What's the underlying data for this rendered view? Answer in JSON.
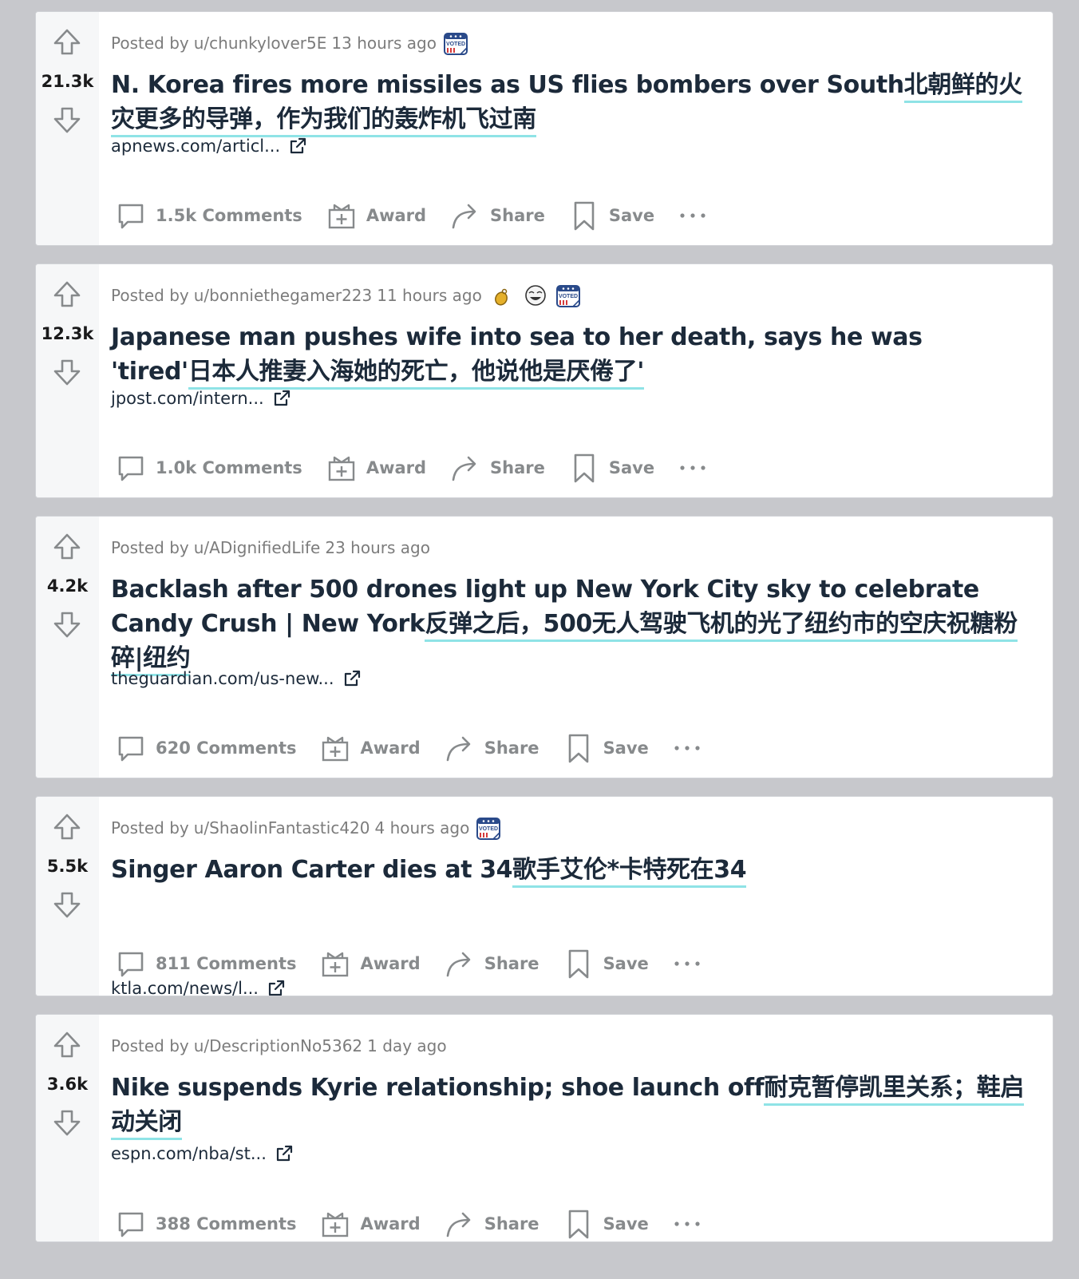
{
  "colors": {
    "page_bg": "#c7c8cc",
    "card_bg": "#ffffff",
    "vote_col_bg": "#f6f7f8",
    "title_text": "#1c2a3a",
    "meta_text": "#7c7c7c",
    "action_text": "#878a8c",
    "translation_underline": "#8fe3e6"
  },
  "labels": {
    "posted_by": "Posted by",
    "award": "Award",
    "share": "Share",
    "save": "Save"
  },
  "posts": [
    {
      "score": "21.3k",
      "author": "u/chunkylover5E",
      "time": "13 hours ago",
      "awards": [
        "voted-sticker-icon"
      ],
      "title": "N. Korea fires more missiles as US flies bombers over South",
      "translation": "北朝鲜的火灾更多的导弹，作为我们的轰炸机飞过南",
      "link": "apnews.com/articl...",
      "comments": "1.5k Comments"
    },
    {
      "score": "12.3k",
      "author": "u/bonniethegamer223",
      "time": "11 hours ago",
      "awards": [
        "gold-bell-award-icon",
        "laughing-face-award-icon",
        "voted-sticker-icon"
      ],
      "title": "Japanese man pushes wife into sea to her death, says he was 'tired'",
      "translation": "日本人推妻入海她的死亡，他说他是厌倦了'",
      "link": "jpost.com/intern...",
      "comments": "1.0k Comments"
    },
    {
      "score": "4.2k",
      "author": "u/ADignifiedLife",
      "time": "23 hours ago",
      "awards": [],
      "title": "Backlash after 500 drones light up New York City sky to celebrate Candy Crush | New York",
      "translation": "反弹之后，500无人驾驶飞机的光了纽约市的空庆祝糖粉碎|纽约",
      "link": "theguardian.com/us-new...",
      "comments": "620 Comments"
    },
    {
      "score": "5.5k",
      "author": "u/ShaolinFantastic420",
      "time": "4 hours ago",
      "awards": [
        "voted-sticker-icon"
      ],
      "title": "Singer Aaron Carter dies at 34",
      "translation": "歌手艾伦*卡特死在34",
      "link": "ktla.com/news/l...",
      "comments": "811 Comments"
    },
    {
      "score": "3.6k",
      "author": "u/DescriptionNo5362",
      "time": "1 day ago",
      "awards": [],
      "title": "Nike suspends Kyrie relationship; shoe launch off",
      "translation": "耐克暂停凯里关系；鞋启动关闭",
      "link": "espn.com/nba/st...",
      "comments": "388 Comments"
    }
  ]
}
